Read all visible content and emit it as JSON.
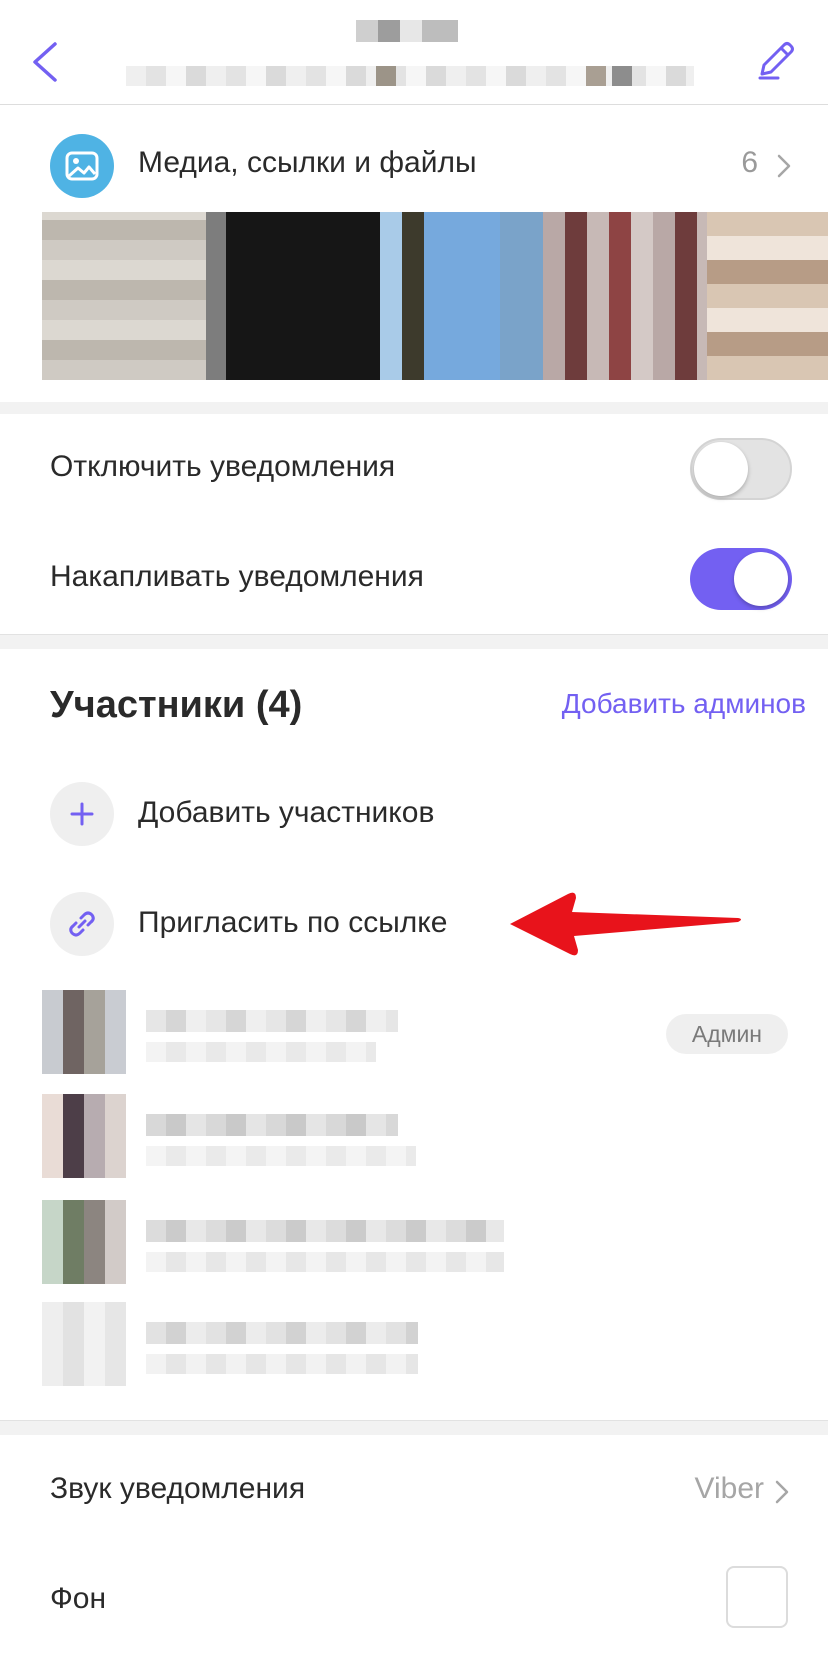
{
  "header": {
    "back_icon": "chevron-left-icon",
    "edit_icon": "pencil-icon",
    "accent": "#7360f2"
  },
  "media": {
    "label": "Медиа, ссылки и файлы",
    "count": "6",
    "icon": "image-icon",
    "icon_color": "#4fb3e4"
  },
  "notifications": {
    "mute_label": "Отключить уведомления",
    "mute_on": false,
    "accumulate_label": "Накапливать уведомления",
    "accumulate_on": true
  },
  "participants": {
    "title": "Участники (4)",
    "add_admins": "Добавить админов",
    "add_members": "Добавить участников",
    "invite_link": "Пригласить по ссылке",
    "admin_badge": "Админ"
  },
  "settings": {
    "sound_label": "Звук уведомления",
    "sound_value": "Viber",
    "background_label": "Фон"
  }
}
